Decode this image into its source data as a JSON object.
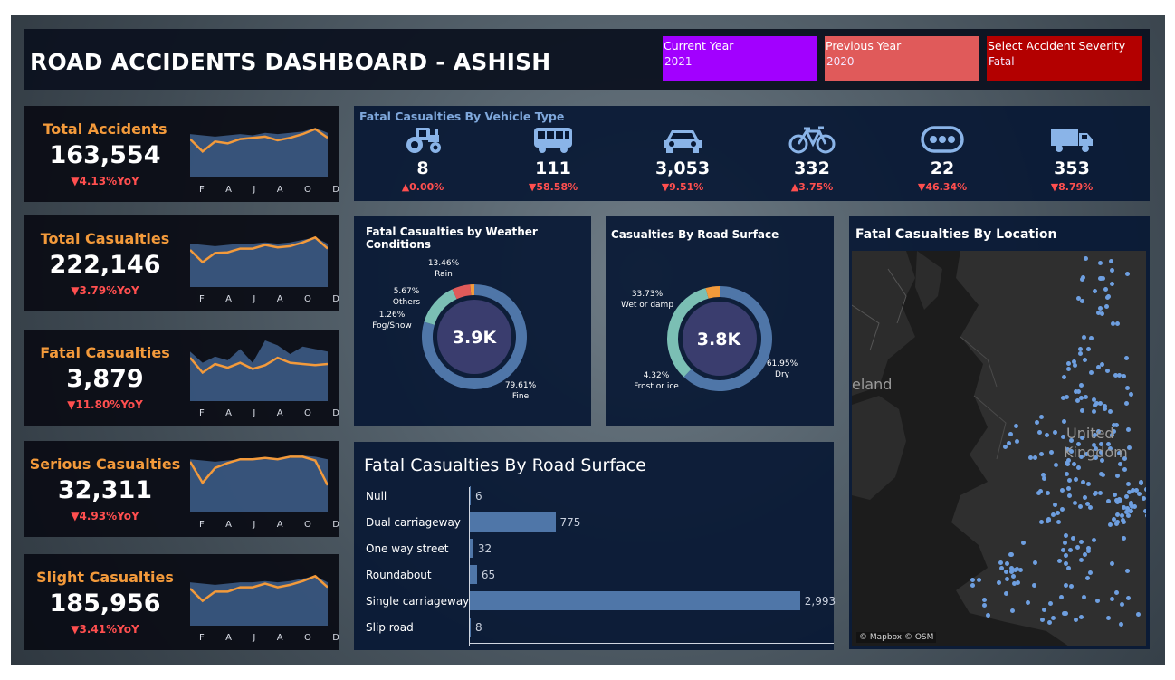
{
  "header": {
    "title": "ROAD ACCIDENTS DASHBOARD - ASHISH",
    "filters": [
      {
        "label": "Current Year",
        "value": "2021",
        "color": "#a200ff"
      },
      {
        "label": "Previous Year",
        "value": "2020",
        "color": "#e05a5a"
      },
      {
        "label": "Select Accident Severity",
        "value": "Fatal",
        "color": "#b30000"
      }
    ]
  },
  "kpis": [
    {
      "label": "Total Accidents",
      "value": "163,554",
      "yoy": "▼4.13%YoY",
      "current": [
        0.62,
        0.42,
        0.58,
        0.55,
        0.62,
        0.64,
        0.66,
        0.6,
        0.64,
        0.7,
        0.78,
        0.64
      ],
      "previous": [
        0.7,
        0.68,
        0.66,
        0.68,
        0.7,
        0.68,
        0.72,
        0.7,
        0.72,
        0.74,
        0.8,
        0.72
      ]
    },
    {
      "label": "Total Casualties",
      "value": "222,146",
      "yoy": "▼3.79%YoY",
      "current": [
        0.6,
        0.4,
        0.55,
        0.56,
        0.62,
        0.62,
        0.68,
        0.64,
        0.66,
        0.72,
        0.8,
        0.62
      ],
      "previous": [
        0.7,
        0.68,
        0.66,
        0.68,
        0.7,
        0.7,
        0.72,
        0.7,
        0.72,
        0.76,
        0.8,
        0.7
      ]
    },
    {
      "label": "Fatal Casualties",
      "value": "3,879",
      "yoy": "▼11.80%YoY",
      "current": [
        0.7,
        0.46,
        0.6,
        0.54,
        0.62,
        0.52,
        0.58,
        0.7,
        0.62,
        0.6,
        0.58,
        0.6
      ],
      "previous": [
        0.8,
        0.62,
        0.72,
        0.66,
        0.84,
        0.62,
        0.98,
        0.9,
        0.76,
        0.88,
        0.84,
        0.8
      ]
    },
    {
      "label": "Serious Casualties",
      "value": "32,311",
      "yoy": "▼4.93%YoY",
      "current": [
        0.82,
        0.48,
        0.72,
        0.8,
        0.86,
        0.86,
        0.88,
        0.86,
        0.9,
        0.9,
        0.84,
        0.44
      ],
      "previous": [
        0.86,
        0.84,
        0.82,
        0.84,
        0.86,
        0.86,
        0.86,
        0.86,
        0.88,
        0.92,
        0.9,
        0.86
      ]
    },
    {
      "label": "Slight Casualties",
      "value": "185,956",
      "yoy": "▼3.41%YoY",
      "current": [
        0.6,
        0.4,
        0.55,
        0.55,
        0.62,
        0.62,
        0.68,
        0.62,
        0.66,
        0.72,
        0.8,
        0.62
      ],
      "previous": [
        0.7,
        0.68,
        0.66,
        0.68,
        0.7,
        0.7,
        0.72,
        0.7,
        0.72,
        0.76,
        0.8,
        0.7
      ]
    }
  ],
  "months": [
    "F",
    "A",
    "J",
    "A",
    "O",
    "D"
  ],
  "vehicles": {
    "title": "Fatal Casualties By Vehicle Type",
    "items": [
      {
        "icon": "tractor-icon",
        "value": "8",
        "change": "▲0.00%"
      },
      {
        "icon": "bus-icon",
        "value": "111",
        "change": "▼58.58%"
      },
      {
        "icon": "car-icon",
        "value": "3,053",
        "change": "▼9.51%"
      },
      {
        "icon": "bicycle-icon",
        "value": "332",
        "change": "▲3.75%"
      },
      {
        "icon": "other-vehicle-icon",
        "value": "22",
        "change": "▼46.34%"
      },
      {
        "icon": "truck-icon",
        "value": "353",
        "change": "▼8.79%"
      }
    ]
  },
  "weather": {
    "title": "Fatal Casualties by Weather Conditions",
    "center": "3.9K"
  },
  "surface_donut": {
    "title": "Casualties By Road Surface",
    "center": "3.8K"
  },
  "bar_panel": {
    "title": "Fatal  Casualties By Road Surface"
  },
  "map": {
    "title": "Fatal  Casualties By Location",
    "ireland_label": "eland",
    "uk_label_1": "United",
    "uk_label_2": "Kingdom",
    "credit": "© Mapbox © OSM"
  },
  "colors": {
    "accent_orange": "#f39a3b",
    "negative": "#ff4f4f",
    "positive": "#ff4f4f",
    "series_blue": "#4f76a8",
    "teal": "#7bbfb4"
  },
  "chart_data": [
    {
      "type": "pie",
      "title": "Fatal Casualties by Weather Conditions",
      "categories": [
        "Fine",
        "Rain",
        "Others",
        "Fog/Snow"
      ],
      "values": [
        79.61,
        13.46,
        5.67,
        1.26
      ],
      "labels": [
        "79.61%",
        "13.46%",
        "5.67%",
        "1.26%"
      ],
      "colors": [
        "#4f76a8",
        "#7bbfb4",
        "#e05a5a",
        "#f39a3b"
      ]
    },
    {
      "type": "pie",
      "title": "Casualties By Road Surface",
      "categories": [
        "Dry",
        "Wet or damp",
        "Frost or ice"
      ],
      "values": [
        61.95,
        33.73,
        4.32
      ],
      "labels": [
        "61.95%",
        "33.73%",
        "4.32%"
      ],
      "colors": [
        "#4f76a8",
        "#7bbfb4",
        "#f39a3b"
      ]
    },
    {
      "type": "bar",
      "title": "Fatal  Casualties By Road Surface",
      "categories": [
        "Null",
        "Dual carriageway",
        "One way street",
        "Roundabout",
        "Single carriageway",
        "Slip road"
      ],
      "values": [
        6,
        775,
        32,
        65,
        2993,
        8
      ],
      "value_labels": [
        "6",
        "775",
        "32",
        "65",
        "2,993",
        "8"
      ],
      "xlim": [
        0,
        3200
      ]
    }
  ]
}
